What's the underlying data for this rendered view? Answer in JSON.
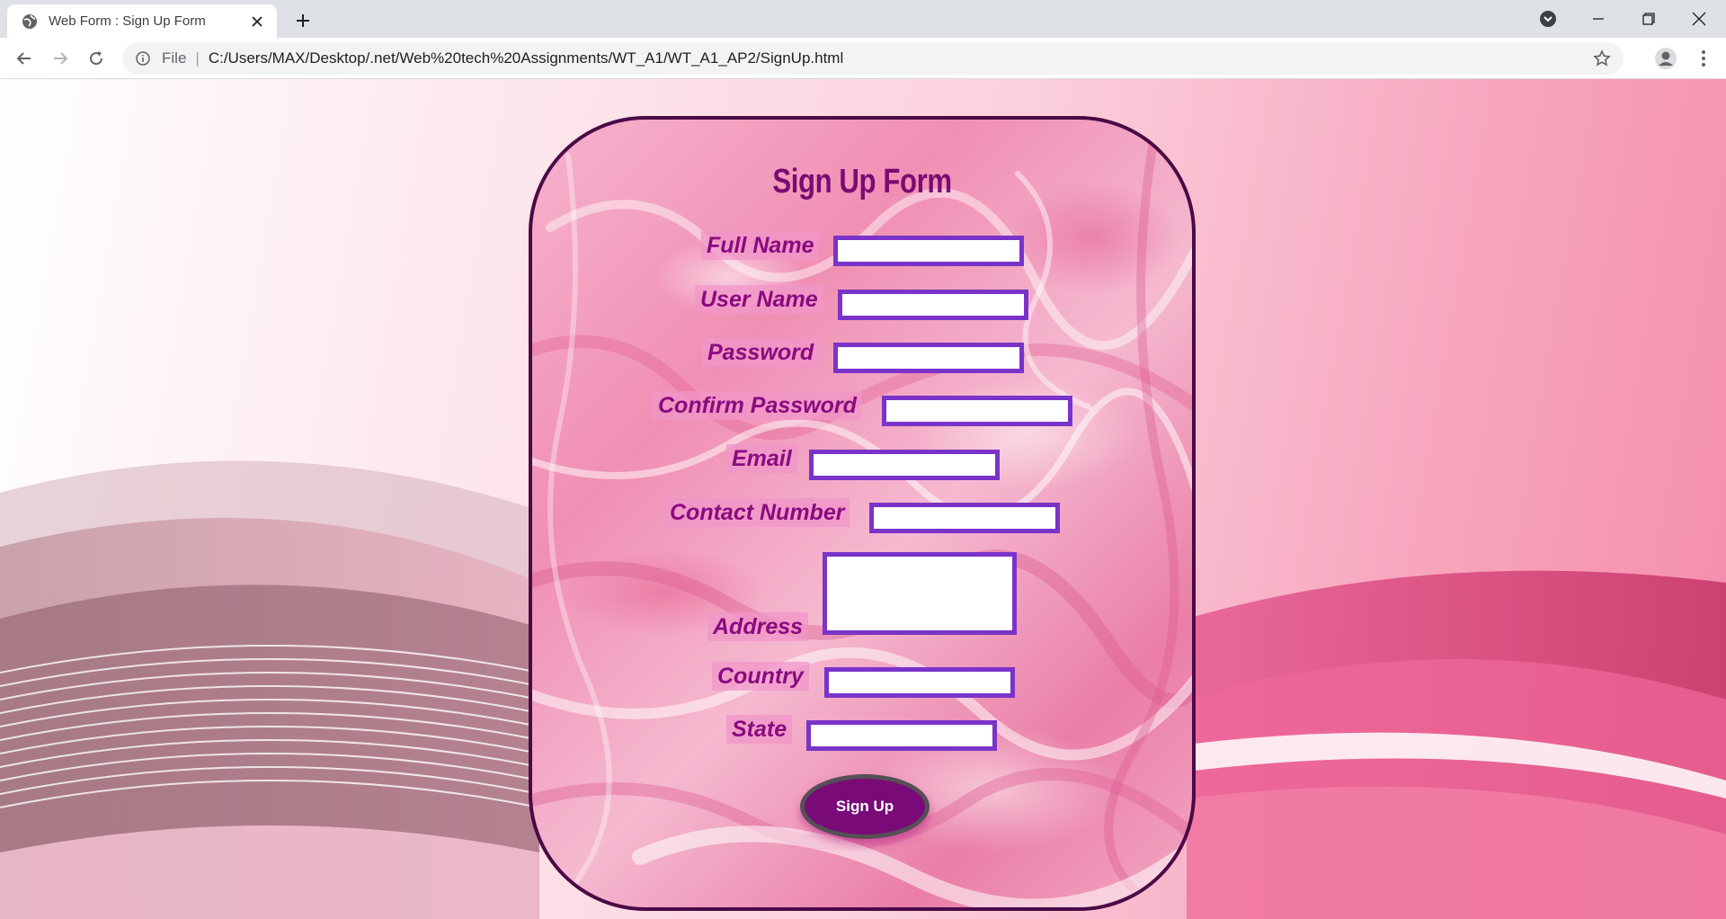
{
  "browser": {
    "tab_title": "Web Form : Sign Up Form",
    "omnibox_scheme": "File",
    "omnibox_separator": "|",
    "url": "C:/Users/MAX/Desktop/.net/Web%20tech%20Assignments/WT_A1/WT_A1_AP2/SignUp.html",
    "icons": [
      "globe-icon",
      "close-icon",
      "plus-icon",
      "back-icon",
      "forward-icon",
      "reload-icon",
      "info-icon",
      "star-icon",
      "profile-icon",
      "menu-icon",
      "tab-search-icon",
      "minimize-icon",
      "maximize-icon",
      "close-window-icon"
    ]
  },
  "form": {
    "title": "Sign Up Form",
    "fields": {
      "full_name": {
        "label": "Full Name",
        "value": ""
      },
      "user_name": {
        "label": "User Name",
        "value": ""
      },
      "password": {
        "label": "Password",
        "value": ""
      },
      "confirm_password": {
        "label": "Confirm Password",
        "value": ""
      },
      "email": {
        "label": "Email",
        "value": ""
      },
      "contact_number": {
        "label": "Contact Number",
        "value": ""
      },
      "address": {
        "label": "Address",
        "value": ""
      },
      "country": {
        "label": "Country",
        "value": ""
      },
      "state": {
        "label": "State",
        "value": ""
      }
    },
    "submit_label": "Sign Up"
  },
  "colors": {
    "label_text": "#8a0a80",
    "field_border": "#7a33c9",
    "button_bg": "#7a0a78",
    "card_border": "#4a0a46"
  }
}
